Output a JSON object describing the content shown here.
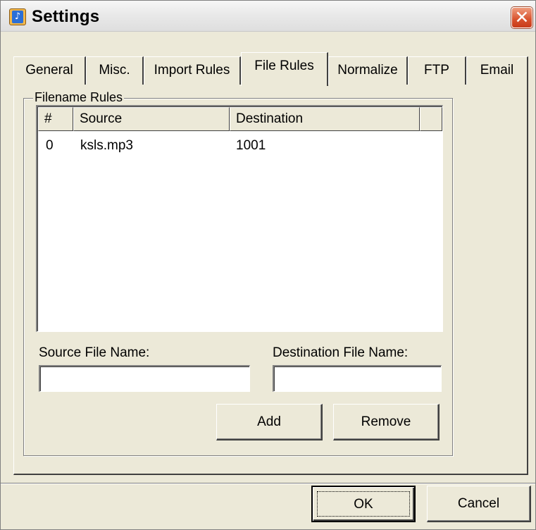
{
  "window": {
    "title": "Settings",
    "app_icon": "audio-note-icon",
    "close_icon": "close-x-icon",
    "close_glyph": "✕"
  },
  "tabs": [
    {
      "label": "General",
      "active": false
    },
    {
      "label": "Misc.",
      "active": false
    },
    {
      "label": "Import Rules",
      "active": false
    },
    {
      "label": "File Rules",
      "active": true
    },
    {
      "label": "Normalize",
      "active": false
    },
    {
      "label": "FTP",
      "active": false
    },
    {
      "label": "Email",
      "active": false
    }
  ],
  "file_rules": {
    "group_title": "Filename Rules",
    "columns": [
      "#",
      "Source",
      "Destination",
      ""
    ],
    "rows": [
      {
        "index": "0",
        "source": "ksls.mp3",
        "destination": "1001"
      }
    ],
    "source_label": "Source File Name:",
    "source_value": "",
    "destination_label": "Destination File Name:",
    "destination_value": "",
    "add_label": "Add",
    "remove_label": "Remove"
  },
  "dialog_buttons": {
    "ok_label": "OK",
    "cancel_label": "Cancel"
  },
  "colors": {
    "dialog_background": "#ece9d8",
    "close_button": "#d8512c",
    "list_background": "#ffffff"
  }
}
